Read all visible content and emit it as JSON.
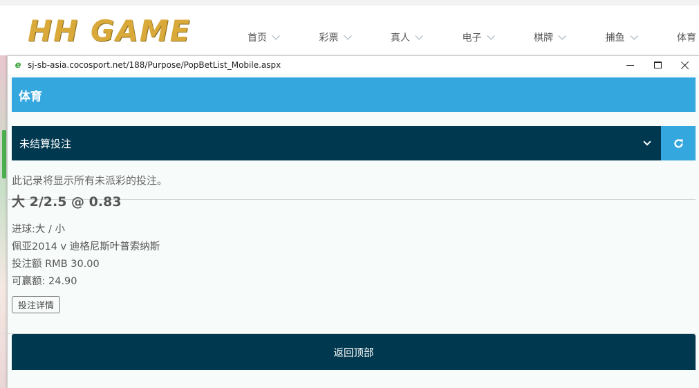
{
  "site": {
    "logo_text": "HH GAME",
    "nav": [
      {
        "label": "首页"
      },
      {
        "label": "彩票"
      },
      {
        "label": "真人"
      },
      {
        "label": "电子"
      },
      {
        "label": "棋牌"
      },
      {
        "label": "捕鱼"
      },
      {
        "label": "体育"
      }
    ]
  },
  "window": {
    "url": "sj-sb-asia.cocosport.net/188/Purpose/PopBetList_Mobile.aspx",
    "icon": "ie-icon"
  },
  "page": {
    "section_title": "体育",
    "select_value": "未结算投注",
    "info_text": "此记录将显示所有未派彩的投注。",
    "bet": {
      "title": "大 2/2.5 @ 0.83",
      "market": "进球:大 / 小",
      "match": "佩亚2014 v 迪格尼斯叶普索纳斯",
      "stake": "投注额 RMB 30.00",
      "win": "可赢额: 24.90",
      "detail_button": "投注详情"
    },
    "back_to_top": "返回顶部"
  },
  "colors": {
    "accent_blue": "#35a7df",
    "dark_navy": "#00384f",
    "logo_gold": "#d9a93a"
  }
}
